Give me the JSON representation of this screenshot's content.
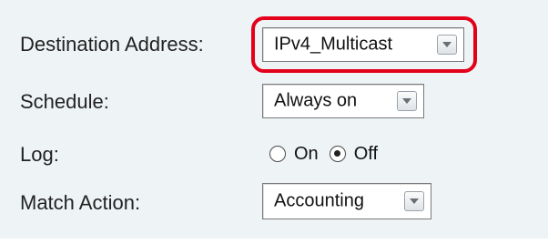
{
  "form": {
    "destination": {
      "label": "Destination Address:",
      "value": "IPv4_Multicast"
    },
    "schedule": {
      "label": "Schedule:",
      "value": "Always on"
    },
    "log": {
      "label": "Log:",
      "options": [
        "On",
        "Off"
      ],
      "selected": "Off"
    },
    "match_action": {
      "label": "Match Action:",
      "value": "Accounting"
    }
  },
  "colors": {
    "highlight": "#e2001a",
    "background": "#eef3f6"
  },
  "icons": {
    "dropdown": "chevron-down-icon",
    "radio": "radio-icon"
  }
}
